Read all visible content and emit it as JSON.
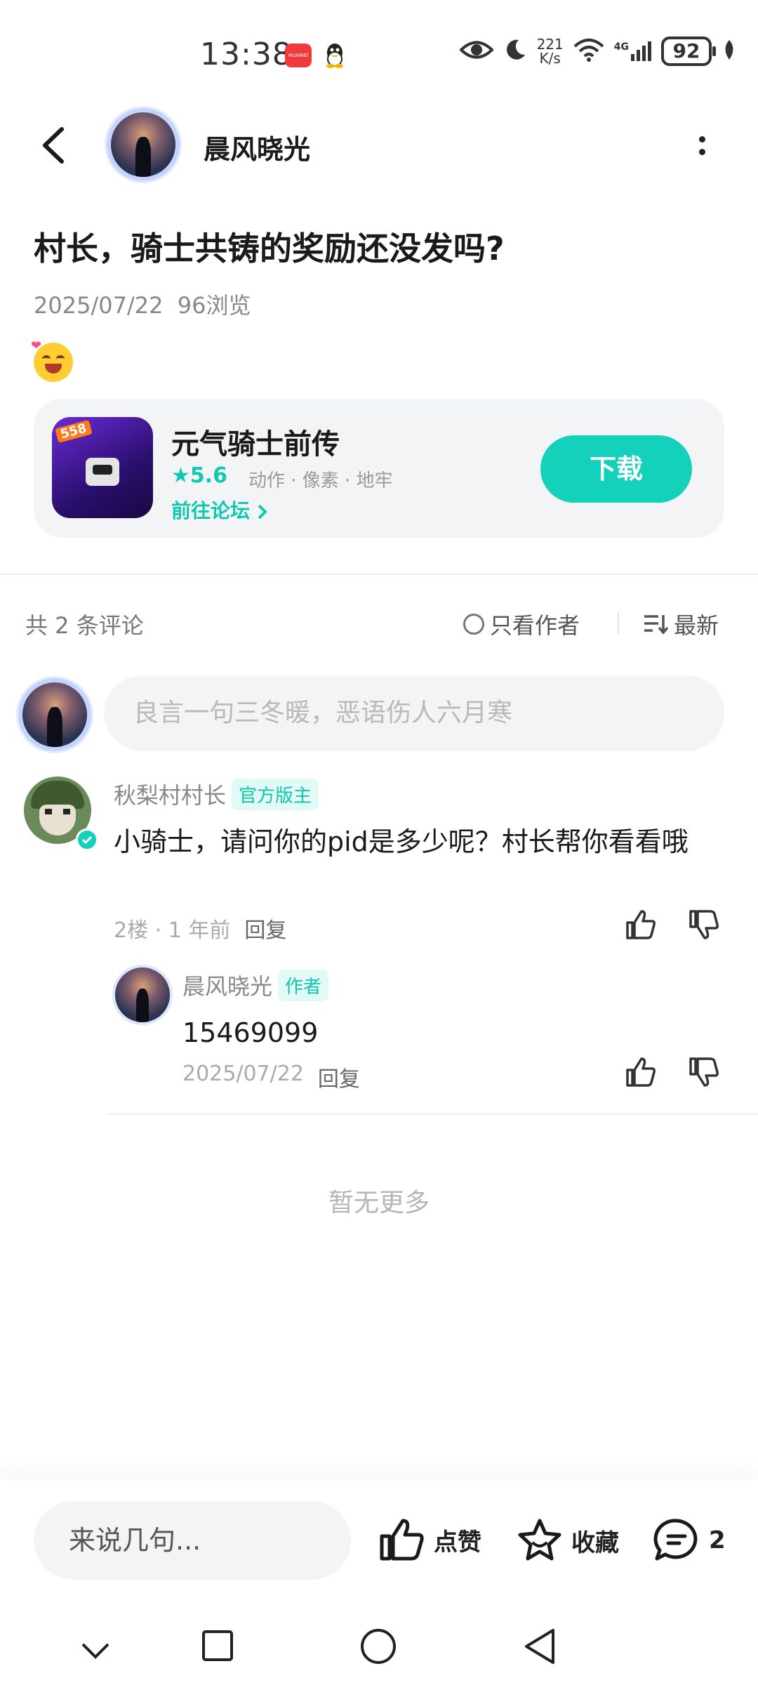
{
  "status_bar": {
    "time": "13:38",
    "app_badge": "HUAWEI",
    "speed_top": "221",
    "speed_bottom": "K/s",
    "network": "4G",
    "battery": "92"
  },
  "header": {
    "user_name": "晨风晓光"
  },
  "post": {
    "title": "村长，骑士共铸的奖励还没发吗?",
    "date": "2025/07/22",
    "views": "96浏览"
  },
  "game_card": {
    "name": "元气骑士前传",
    "icon_tag": "558",
    "rating": "★5.6",
    "tags": "动作 · 像素 · 地牢",
    "forum_link": "前往论坛",
    "download": "下载"
  },
  "comments_header": {
    "count": "共 2 条评论",
    "author_only": "只看作者",
    "sort": "最新"
  },
  "comment_input": {
    "placeholder": "良言一句三冬暖，恶语伤人六月寒"
  },
  "comments": [
    {
      "name": "秋梨村村长",
      "badge": "官方版主",
      "text": "小骑士，请问你的pid是多少呢？村长帮你看看哦",
      "floor": "2楼",
      "time": "1 年前",
      "reply": "回复"
    }
  ],
  "reply": {
    "name": "晨风晓光",
    "badge": "作者",
    "text": "15469099",
    "date": "2025/07/22",
    "reply": "回复"
  },
  "no_more": "暂无更多",
  "bottom_bar": {
    "input": "来说几句...",
    "like": "点赞",
    "favorite": "收藏",
    "comment_count": "2"
  },
  "colors": {
    "accent": "#13d1bb",
    "badge_bg": "#e2faf6"
  }
}
